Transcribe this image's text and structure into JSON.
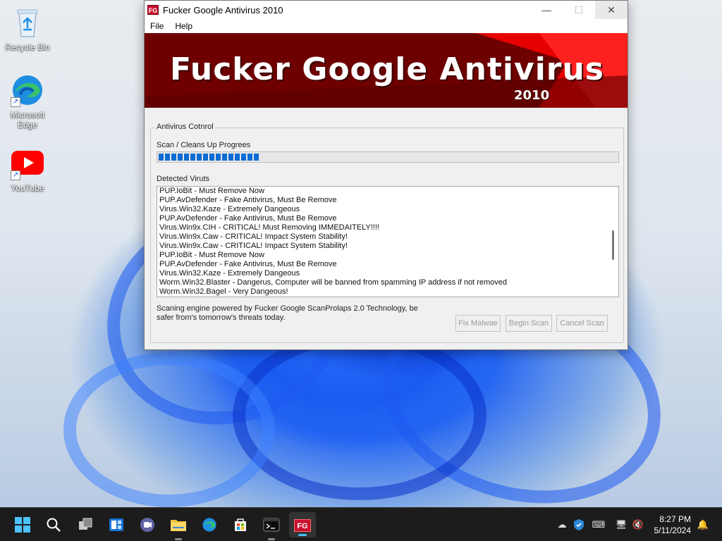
{
  "desktop": {
    "icons": [
      {
        "label": "Recycle Bin"
      },
      {
        "label": "Microsoft Edge"
      },
      {
        "label": "YouTube"
      }
    ]
  },
  "window": {
    "title": "Fucker Google Antivirus 2010",
    "app_icon_text": "FG",
    "menu": [
      "File",
      "Help"
    ],
    "banner": {
      "title": "Fucker Google Antivirus",
      "year": "2010"
    },
    "group_title": "Antivirus Cotnrol",
    "progress_label": "Scan / Cleans Up Progrees",
    "progress_percent": 22,
    "detected_label": "Detected Viruts",
    "detected_items": [
      "PUP.IoBit - Must Remove Now",
      "PUP.AvDefender - Fake Antivirus, Must Be Remove",
      "Virus.Win32.Kaze  - Extremely Dangeous",
      "PUP.AvDefender - Fake Antivirus, Must Be Remove",
      "Virus.Win9x.CIH - CRITICAL! Must Removing IMMEDAITELY!!!!",
      "Virus.Win9x.Caw - CRITICAL! Impact System Stability!",
      "Virus.Win9x.Caw - CRITICAL! Impact System Stability!",
      "PUP.IoBit - Must Remove Now",
      "PUP.AvDefender - Fake Antivirus, Must Be Remove",
      "Virus.Win32.Kaze  - Extremely Dangeous",
      "Worm.Win32.Blaster - Dangerus, Computer will be banned from spamming IP address if not removed",
      "Worm.Win32.Bagel - Very Dangeous!"
    ],
    "footer_text": "Scaning engine powered by Fucker Google ScanProlaps 2.0 Technology, be safer from's tomorrow's threats today.",
    "buttons": {
      "fix": "Fix Malwae",
      "begin": "Begin Scan",
      "cancel": "Cancel Scan"
    }
  },
  "taskbar": {
    "app_icon_text": "FG",
    "clock": {
      "time": "8:27 PM",
      "date": "5/11/2024"
    }
  },
  "colors": {
    "progress": "#0a6cd4",
    "banner_dark": "#6a0000",
    "banner_bright": "#ff1a1a",
    "taskbar": "#1c1c1c"
  }
}
